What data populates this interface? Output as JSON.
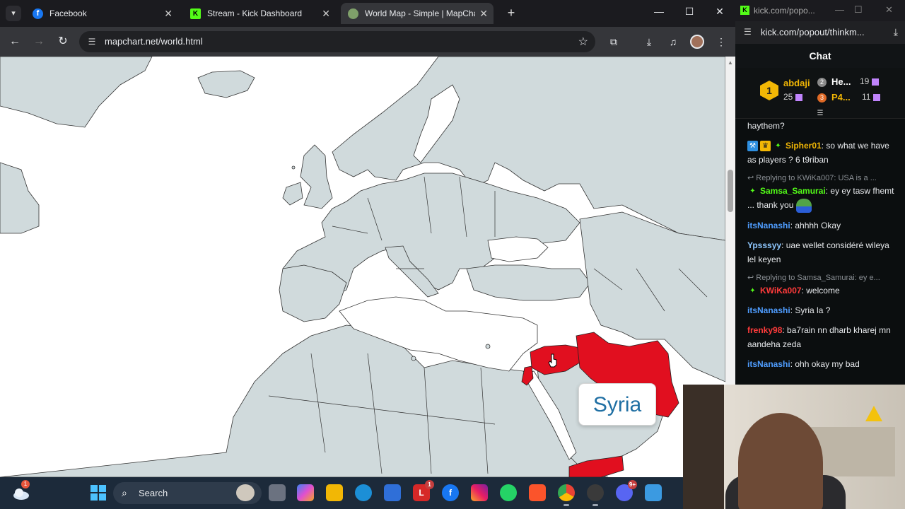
{
  "browser": {
    "tabs": [
      {
        "title": "Facebook",
        "icon": "facebook-icon"
      },
      {
        "title": "Stream - Kick Dashboard",
        "icon": "kick-icon"
      },
      {
        "title": "World Map - Simple | MapChart",
        "icon": "globe-icon"
      }
    ],
    "url": "mapchart.net/world.html"
  },
  "map": {
    "tooltip": "Syria",
    "highlight_color": "#e10f1f",
    "land_color": "#d0dadc",
    "highlighted_countries": [
      "Syria",
      "Iraq",
      "Lebanon",
      "Yemen"
    ]
  },
  "chat_window": {
    "title_url": "kick.com/popo...",
    "url": "kick.com/popout/thinkm...",
    "heading": "Chat",
    "leaderboard": {
      "first": {
        "rank": "1",
        "name": "abdaji",
        "count": "25"
      },
      "second": {
        "rank": "2",
        "name": "He...",
        "count": "19"
      },
      "third": {
        "rank": "3",
        "name": "P4...",
        "count": "11"
      }
    },
    "messages": [
      {
        "user": "",
        "user_color": "#9b7bff",
        "text": "haythem?",
        "partial": true
      },
      {
        "user": "Sipher01",
        "user_color": "#f2b705",
        "text": "so what we have as players ? 6 t9riban",
        "badges": [
          "moderator-badge",
          "crown-badge",
          "sparkle-badge"
        ]
      },
      {
        "reply": "Replying to KWiKa007: USA is a ...",
        "user": "Samsa_Samurai",
        "user_color": "#53fc18",
        "text": "ey ey tasw fhemt ... thank you",
        "badges": [
          "sparkle-badge"
        ],
        "emote": "pepe-emote"
      },
      {
        "user": "itsNanashi",
        "user_color": "#4f9dff",
        "text": "ahhhh Okay"
      },
      {
        "user": "Ypsssyy",
        "user_color": "#8fc8ff",
        "text": "uae wellet considéré wileya lel keyen"
      },
      {
        "reply": "Replying to Samsa_Samurai: ey e...",
        "user": "KWiKa007",
        "user_color": "#ff3b3b",
        "text": "welcome",
        "badges": [
          "sparkle-badge"
        ]
      },
      {
        "user": "itsNanashi",
        "user_color": "#4f9dff",
        "text": "Syria la ?"
      },
      {
        "user": "frenky98",
        "user_color": "#ff3b3b",
        "text": "ba7rain nn dharb kharej mn aandeha zeda"
      },
      {
        "user": "itsNanashi",
        "user_color": "#4f9dff",
        "text": "ohh okay my bad"
      }
    ]
  },
  "taskbar": {
    "search_label": "Search",
    "weather_badge": "1",
    "apps": [
      {
        "name": "file-explorer",
        "label": ""
      },
      {
        "name": "m365",
        "label": ""
      },
      {
        "name": "folder",
        "label": ""
      },
      {
        "name": "edge",
        "label": ""
      },
      {
        "name": "store",
        "label": ""
      },
      {
        "name": "l-app",
        "label": "L",
        "count": "1"
      },
      {
        "name": "facebook",
        "label": "f"
      },
      {
        "name": "instagram",
        "label": ""
      },
      {
        "name": "whatsapp",
        "label": ""
      },
      {
        "name": "brave",
        "label": ""
      },
      {
        "name": "chrome",
        "label": ""
      },
      {
        "name": "obs",
        "label": ""
      },
      {
        "name": "discord",
        "label": "",
        "count": "9+"
      },
      {
        "name": "paint",
        "label": ""
      }
    ]
  }
}
